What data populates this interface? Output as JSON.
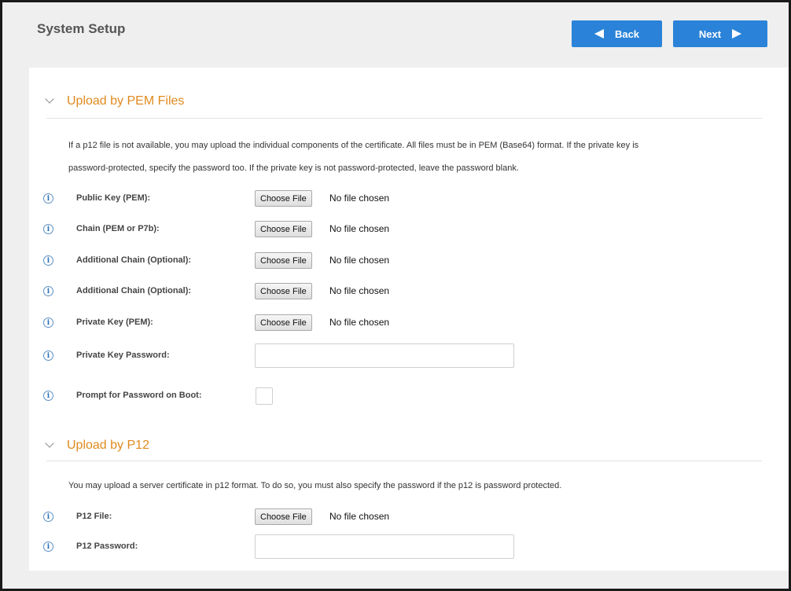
{
  "header": {
    "title": "System Setup",
    "back_label": "Back",
    "next_label": "Next"
  },
  "pem": {
    "title": "Upload by PEM Files",
    "description_line1": "If a p12 file is not available, you may upload the individual components of the certificate. All files must be in PEM (Base64) format. If the private key is",
    "description_line2": "password-protected, specify the password too. If the private key is not password-protected, leave the password blank.",
    "fields": [
      {
        "label": "Public Key (PEM):",
        "button": "Choose File",
        "status": "No file chosen"
      },
      {
        "label": "Chain (PEM or P7b):",
        "button": "Choose File",
        "status": "No file chosen"
      },
      {
        "label": "Additional Chain (Optional):",
        "button": "Choose File",
        "status": "No file chosen"
      },
      {
        "label": "Additional Chain (Optional):",
        "button": "Choose File",
        "status": "No file chosen"
      },
      {
        "label": "Private Key (PEM):",
        "button": "Choose File",
        "status": "No file chosen"
      }
    ],
    "password_label": "Private Key Password:",
    "password_value": "",
    "prompt_label": "Prompt for Password on Boot:",
    "prompt_checked": false
  },
  "p12": {
    "title": "Upload by P12",
    "description": "You may upload a server certificate in p12 format. To do so, you must also specify the password if the p12 is password protected.",
    "file_label": "P12 File:",
    "file_button": "Choose File",
    "file_status": "No file chosen",
    "password_label": "P12 Password:",
    "password_value": ""
  },
  "icons": {
    "info": "info-icon",
    "collapse": "chevron-down-icon",
    "back": "triangle-left-icon",
    "next": "triangle-right-icon"
  },
  "colors": {
    "accent_blue": "#2a83d8",
    "section_orange": "#e08a1e"
  }
}
